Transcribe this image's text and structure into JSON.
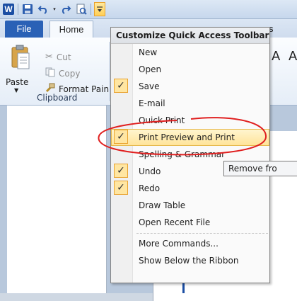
{
  "qat": {
    "app_icon_text": "W",
    "icons": [
      "word-icon",
      "save-icon",
      "undo-icon",
      "redo-icon",
      "print-preview-icon",
      "customize-dropdown-icon"
    ]
  },
  "ribbon": {
    "tabs": {
      "file": "File",
      "home": "Home",
      "partial": "s"
    },
    "paste_label": "Paste",
    "cut_label": "Cut",
    "copy_label": "Copy",
    "format_painter_label": "Format Pain",
    "group_label": "Clipboard",
    "partial_glyph_a": "A",
    "partial_glyph_b": "A"
  },
  "menu": {
    "title": "Customize Quick Access Toolbar",
    "items": [
      {
        "label": "New",
        "checked": false
      },
      {
        "label": "Open",
        "checked": false
      },
      {
        "label": "Save",
        "checked": true
      },
      {
        "label": "E-mail",
        "checked": false
      },
      {
        "label": "Quick Print",
        "checked": false
      },
      {
        "label": "Print Preview and Print",
        "checked": true,
        "highlighted": true
      },
      {
        "label": "Spelling & Grammar",
        "checked": false
      },
      {
        "label": "Undo",
        "checked": true
      },
      {
        "label": "Redo",
        "checked": true
      },
      {
        "label": "Draw Table",
        "checked": false
      },
      {
        "label": "Open Recent File",
        "checked": false
      },
      {
        "label": "More Commands...",
        "checked": false
      },
      {
        "label": "Show Below the Ribbon",
        "checked": false
      }
    ]
  },
  "tooltip": {
    "text": "Remove fro"
  },
  "colors": {
    "accent": "#2a61b6",
    "annotation": "#e02020",
    "highlight": "#ffe49a"
  }
}
